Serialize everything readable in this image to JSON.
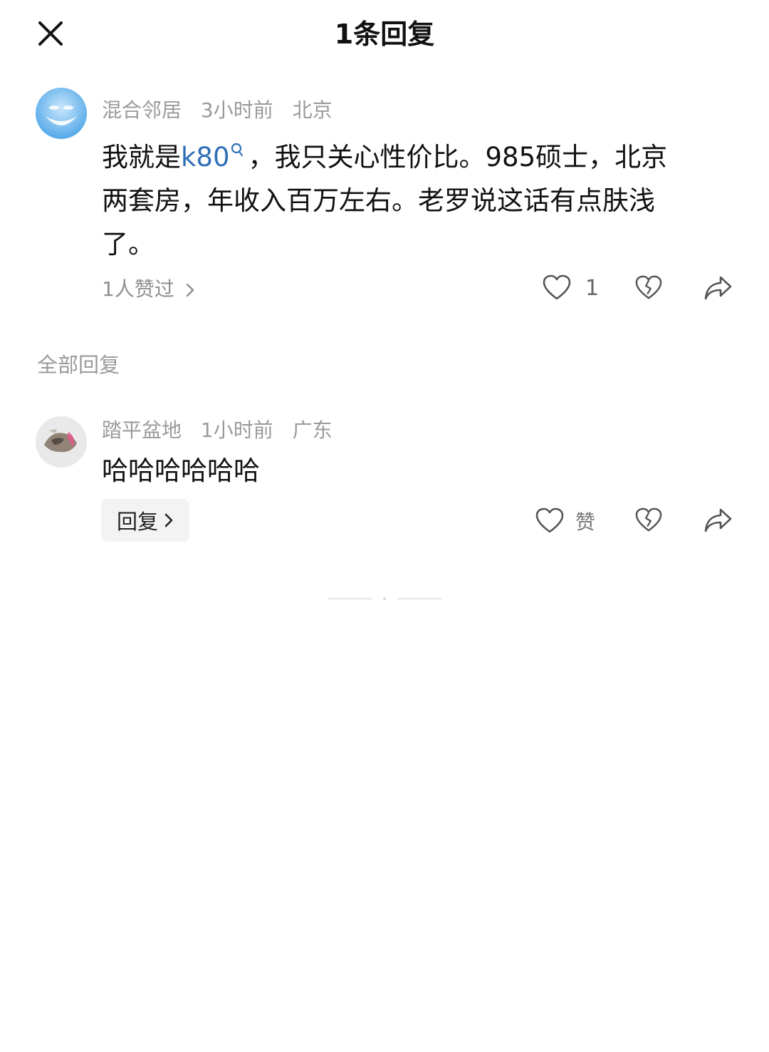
{
  "header": {
    "title": "1条回复"
  },
  "main_comment": {
    "username": "混合邻居",
    "time": "3小时前",
    "location": "北京",
    "text_before_link": "我就是",
    "link_text": "k80",
    "text_line1_after": "，我只关心性价比。985硕士，北京",
    "text_line2": "两套房，年收入百万左右。老罗说这话有点肤浅",
    "text_line3": "了。",
    "likers_label": "1人赞过",
    "like_count": "1"
  },
  "replies_section": {
    "title": "全部回复"
  },
  "reply": {
    "username": "踏平盆地",
    "time": "1小时前",
    "location": "广东",
    "text": "哈哈哈哈哈哈",
    "reply_button_label": "回复",
    "like_label": "赞"
  },
  "colors": {
    "link": "#2f6fb7",
    "meta": "#9a9a9a",
    "text": "#111111",
    "reply_button_bg": "#f3f3f3"
  },
  "icons": {
    "close": "close-icon",
    "like": "heart-icon",
    "dislike": "broken-heart-icon",
    "share": "share-icon",
    "chevron": "chevron-right-icon",
    "search": "search-icon"
  }
}
